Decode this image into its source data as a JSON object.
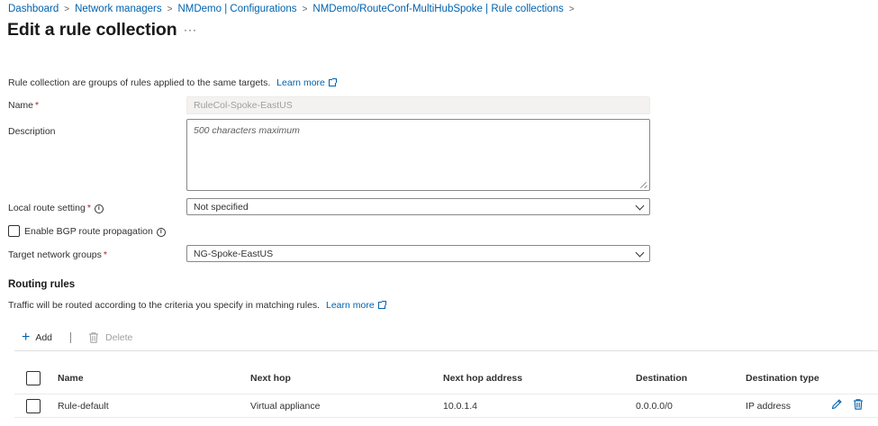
{
  "breadcrumb": [
    {
      "label": "Dashboard"
    },
    {
      "label": "Network managers"
    },
    {
      "label": "NMDemo | Configurations"
    },
    {
      "label": "NMDemo/RouteConf-MultiHubSpoke | Rule collections"
    }
  ],
  "page_title": "Edit a rule collection",
  "more_label": "···",
  "intro": {
    "text": "Rule collection are groups of rules applied to the same targets.",
    "learn_more": "Learn more"
  },
  "form": {
    "name": {
      "label": "Name",
      "required_mark": "*",
      "value": "RuleCol-Spoke-EastUS"
    },
    "description": {
      "label": "Description",
      "placeholder": "500 characters maximum"
    },
    "local_route": {
      "label": "Local route setting",
      "required_mark": "*",
      "value": "Not specified"
    },
    "bgp": {
      "label": "Enable BGP route propagation",
      "checked": false
    },
    "target_groups": {
      "label": "Target network groups",
      "required_mark": "*",
      "value": "NG-Spoke-EastUS"
    }
  },
  "routing": {
    "title": "Routing rules",
    "description": "Traffic will be routed according to the criteria you specify in matching rules.",
    "learn_more": "Learn more",
    "toolbar": {
      "add_label": "Add",
      "delete_label": "Delete"
    },
    "columns": [
      "Name",
      "Next hop",
      "Next hop address",
      "Destination",
      "Destination type"
    ],
    "rows": [
      {
        "name": "Rule-default",
        "next_hop": "Virtual appliance",
        "next_hop_address": "10.0.1.4",
        "destination": "0.0.0.0/0",
        "destination_type": "IP address"
      }
    ]
  },
  "colors": {
    "link": "#0062ad",
    "required": "#a4262c",
    "text": "#323130"
  },
  "icons": [
    "chevron-right-icon",
    "external-link-icon",
    "info-icon",
    "chevron-down-icon",
    "plus-icon",
    "trash-icon",
    "pencil-icon"
  ]
}
